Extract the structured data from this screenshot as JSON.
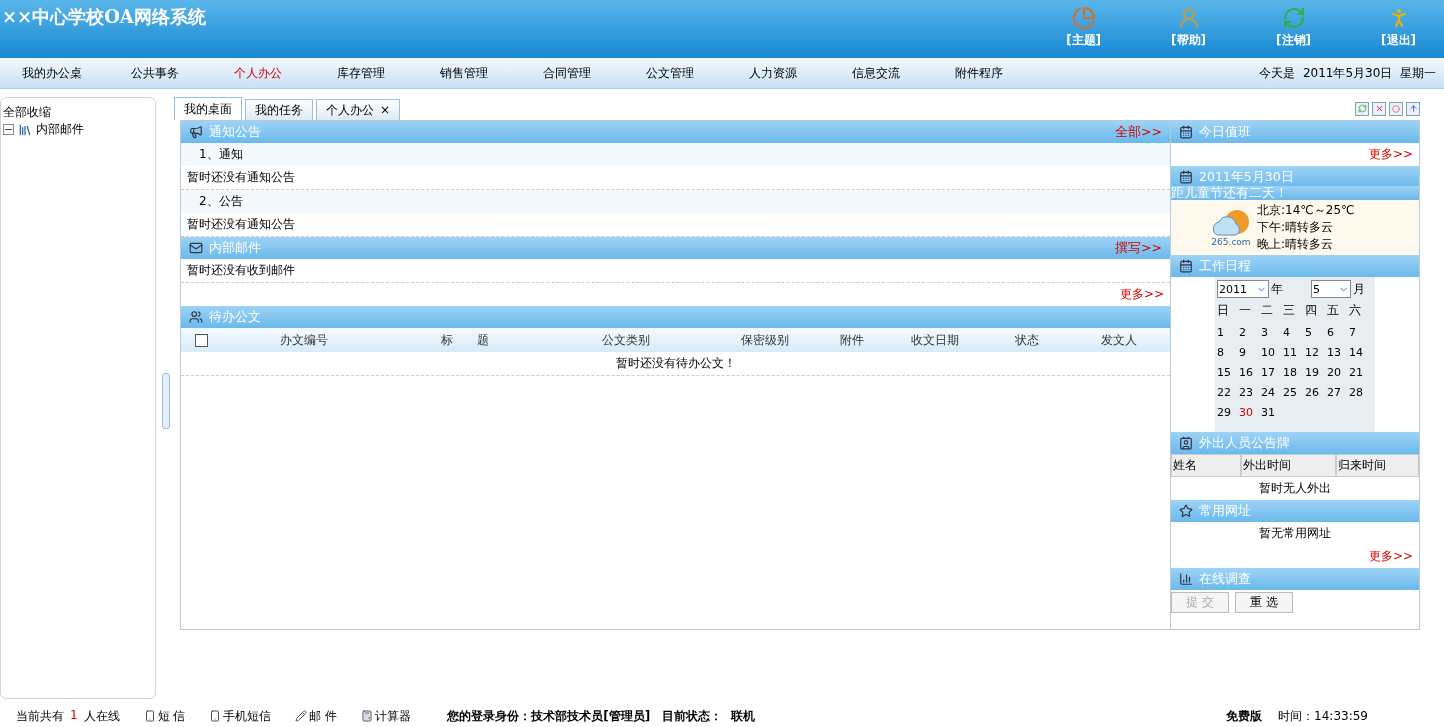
{
  "header": {
    "title": "××中心学校OA网络系统",
    "actions": [
      {
        "label": "[主题]"
      },
      {
        "label": "[帮助]"
      },
      {
        "label": "[注销]"
      },
      {
        "label": "[退出]"
      }
    ]
  },
  "nav": {
    "items": [
      {
        "label": "我的办公桌",
        "selected": false
      },
      {
        "label": "公共事务",
        "selected": false
      },
      {
        "label": "个人办公",
        "selected": true
      },
      {
        "label": "库存管理",
        "selected": false
      },
      {
        "label": "销售管理",
        "selected": false
      },
      {
        "label": "合同管理",
        "selected": false
      },
      {
        "label": "公文管理",
        "selected": false
      },
      {
        "label": "人力资源",
        "selected": false
      },
      {
        "label": "信息交流",
        "selected": false
      },
      {
        "label": "附件程序",
        "selected": false
      }
    ],
    "date": "今天是  2011年5月30日  星期一"
  },
  "sidebar": {
    "collapse_all": "全部收缩",
    "tree": [
      {
        "label": "内部邮件",
        "expanded": true
      }
    ]
  },
  "tabs": [
    {
      "label": "我的桌面",
      "selected": true,
      "closable": false
    },
    {
      "label": "我的任务",
      "selected": false,
      "closable": false
    },
    {
      "label": "个人办公",
      "selected": false,
      "closable": true,
      "close": "×"
    }
  ],
  "notices": {
    "title": "通知公告",
    "link": "全部>>",
    "groups": [
      {
        "label": "1、通知",
        "empty": "暂时还没有通知公告"
      },
      {
        "label": "2、公告",
        "empty": "暂时还没有通知公告"
      }
    ]
  },
  "mail": {
    "title": "内部邮件",
    "link": "撰写>>",
    "empty": "暂时还没有收到邮件",
    "more": "更多>>"
  },
  "documents": {
    "title": "待办公文",
    "select_all": {
      "checked": false
    },
    "columns": [
      "办文编号",
      "标　　题",
      "公文类别",
      "保密级别",
      "附件",
      "收文日期",
      "状态",
      "发文人"
    ],
    "empty": "暂时还没有待办公文！"
  },
  "duty": {
    "title": "今日值班",
    "more": "更多>>"
  },
  "today": {
    "title": "2011年5月30日",
    "countdown": "距儿童节还有二天！",
    "weather_logo": "265.com",
    "weather": [
      "北京:14℃～25℃",
      "下午:晴转多云",
      "晚上:晴转多云"
    ]
  },
  "schedule": {
    "title": "工作日程",
    "year": "2011",
    "year_unit": "年",
    "month": "5",
    "month_unit": "月",
    "weekdays": [
      "日",
      "一",
      "二",
      "三",
      "四",
      "五",
      "六"
    ],
    "days": [
      {
        "label": "1",
        "selected": false
      },
      {
        "label": "2",
        "selected": false
      },
      {
        "label": "3",
        "selected": false
      },
      {
        "label": "4",
        "selected": false
      },
      {
        "label": "5",
        "selected": false
      },
      {
        "label": "6",
        "selected": false
      },
      {
        "label": "7",
        "selected": false
      },
      {
        "label": "8",
        "selected": false
      },
      {
        "label": "9",
        "selected": false
      },
      {
        "label": "10",
        "selected": false
      },
      {
        "label": "11",
        "selected": false
      },
      {
        "label": "12",
        "selected": false
      },
      {
        "label": "13",
        "selected": false
      },
      {
        "label": "14",
        "selected": false
      },
      {
        "label": "15",
        "selected": false
      },
      {
        "label": "16",
        "selected": false
      },
      {
        "label": "17",
        "selected": false
      },
      {
        "label": "18",
        "selected": false
      },
      {
        "label": "19",
        "selected": false
      },
      {
        "label": "20",
        "selected": false
      },
      {
        "label": "21",
        "selected": false
      },
      {
        "label": "22",
        "selected": false
      },
      {
        "label": "23",
        "selected": false
      },
      {
        "label": "24",
        "selected": false
      },
      {
        "label": "25",
        "selected": false
      },
      {
        "label": "26",
        "selected": false
      },
      {
        "label": "27",
        "selected": false
      },
      {
        "label": "28",
        "selected": false
      },
      {
        "label": "29",
        "selected": false
      },
      {
        "label": "30",
        "selected": true
      },
      {
        "label": "31",
        "selected": false
      }
    ]
  },
  "outings": {
    "title": "外出人员公告牌",
    "columns": [
      "姓名",
      "外出时间",
      "归来时间"
    ],
    "empty": "暂时无人外出"
  },
  "links": {
    "title": "常用网址",
    "empty": "暂无常用网址",
    "more": "更多>>"
  },
  "survey": {
    "title": "在线调查",
    "buttons": [
      {
        "label": "提 交",
        "disabled": true
      },
      {
        "label": "重 选",
        "disabled": false
      }
    ]
  },
  "status": {
    "online_prefix": "当前共有",
    "online_count": "1",
    "online_suffix": "人在线",
    "tools": [
      {
        "label": "短 信"
      },
      {
        "label": "手机短信"
      },
      {
        "label": "邮 件"
      },
      {
        "label": "计算器"
      }
    ],
    "identity": "您的登录身份：技术部技术员[管理员]　目前状态：  联机",
    "edition": "免费版",
    "time": "时间：14:33:59"
  }
}
